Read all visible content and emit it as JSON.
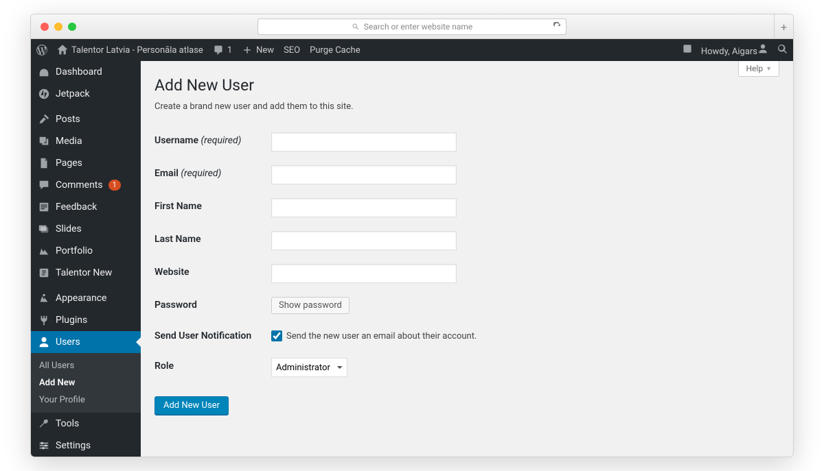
{
  "browser": {
    "search_placeholder": "Search or enter website name"
  },
  "adminbar": {
    "site_name": "Talentor Latvia - Personāla atlase",
    "comments_count": "1",
    "new_label": "New",
    "seo_label": "SEO",
    "purge_label": "Purge Cache",
    "howdy": "Howdy, Aigars"
  },
  "sidebar": {
    "items": [
      {
        "label": "Dashboard"
      },
      {
        "label": "Jetpack"
      },
      {
        "label": "Posts"
      },
      {
        "label": "Media"
      },
      {
        "label": "Pages"
      },
      {
        "label": "Comments",
        "badge": "1"
      },
      {
        "label": "Feedback"
      },
      {
        "label": "Slides"
      },
      {
        "label": "Portfolio"
      },
      {
        "label": "Talentor New"
      },
      {
        "label": "Appearance"
      },
      {
        "label": "Plugins"
      },
      {
        "label": "Users"
      },
      {
        "label": "Tools"
      },
      {
        "label": "Settings"
      }
    ],
    "submenu": {
      "all_users": "All Users",
      "add_new": "Add New",
      "your_profile": "Your Profile"
    }
  },
  "page": {
    "help": "Help",
    "title": "Add New User",
    "description": "Create a brand new user and add them to this site.",
    "labels": {
      "username": "Username",
      "email": "Email",
      "first_name": "First Name",
      "last_name": "Last Name",
      "website": "Website",
      "password": "Password",
      "notification": "Send User Notification",
      "role": "Role",
      "required": "(required)"
    },
    "show_password": "Show password",
    "notification_text": "Send the new user an email about their account.",
    "notification_checked": true,
    "role_value": "Administrator",
    "submit": "Add New User"
  }
}
